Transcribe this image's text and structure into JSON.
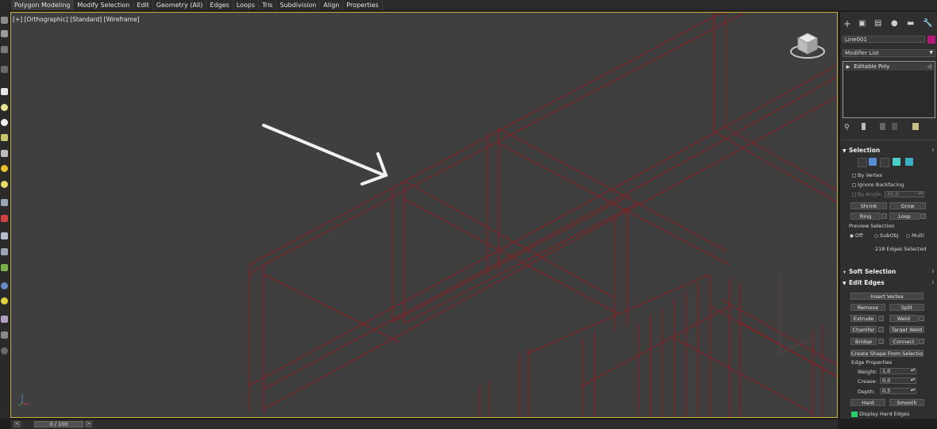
{
  "ribbon": {
    "tabs": [
      "Polygon Modeling",
      "Modify Selection",
      "Edit",
      "Geometry (All)",
      "Edges",
      "Loops",
      "Tris",
      "Subdivision",
      "Align",
      "Properties"
    ]
  },
  "viewport": {
    "label": "[+] [Orthographic] [Standard] [Wireframe]"
  },
  "panel": {
    "icons": [
      "create-icon",
      "modify-icon",
      "hierarchy-icon",
      "motion-icon",
      "display-icon",
      "utilities-icon"
    ],
    "object_name": "Line001",
    "object_color": "#b5177a",
    "modifier_list": "Modifier List",
    "stack_item": "Editable Poly",
    "selection": {
      "title": "Selection",
      "by_vertex": "By Vertex",
      "ignore_backfacing": "Ignore Backfacing",
      "by_angle": "By Angle:",
      "angle_value": "45,0",
      "shrink": "Shrink",
      "grow": "Grow",
      "ring": "Ring",
      "loop": "Loop",
      "preview_title": "Preview Selection",
      "off": "Off",
      "subobj": "SubObj",
      "multi": "Multi",
      "status": "218 Edges Selected"
    },
    "soft_selection": {
      "title": "Soft Selection"
    },
    "edit_edges": {
      "title": "Edit Edges",
      "insert_vertex": "Insert Vertex",
      "remove": "Remove",
      "split": "Split",
      "extrude": "Extrude",
      "weld": "Weld",
      "chamfer": "Chamfer",
      "target_weld": "Target Weld",
      "bridge": "Bridge",
      "connect": "Connect",
      "create_shape": "Create Shape From Selection",
      "edge_properties": "Edge Properties",
      "weight_label": "Weight:",
      "weight": "1,0",
      "crease_label": "Crease:",
      "crease": "0,0",
      "depth_label": "Depth:",
      "depth": "0,5",
      "hard": "Hard",
      "smooth": "Smooth",
      "display_hard_edges": "Display Hard Edges"
    }
  },
  "timeline": {
    "value": "0 / 100"
  },
  "colors": {
    "wire": "#8a1a1c",
    "viewport_bg": "#3f3f3f",
    "active_border": "#c7b23a",
    "accent": "#5a8ad0"
  }
}
